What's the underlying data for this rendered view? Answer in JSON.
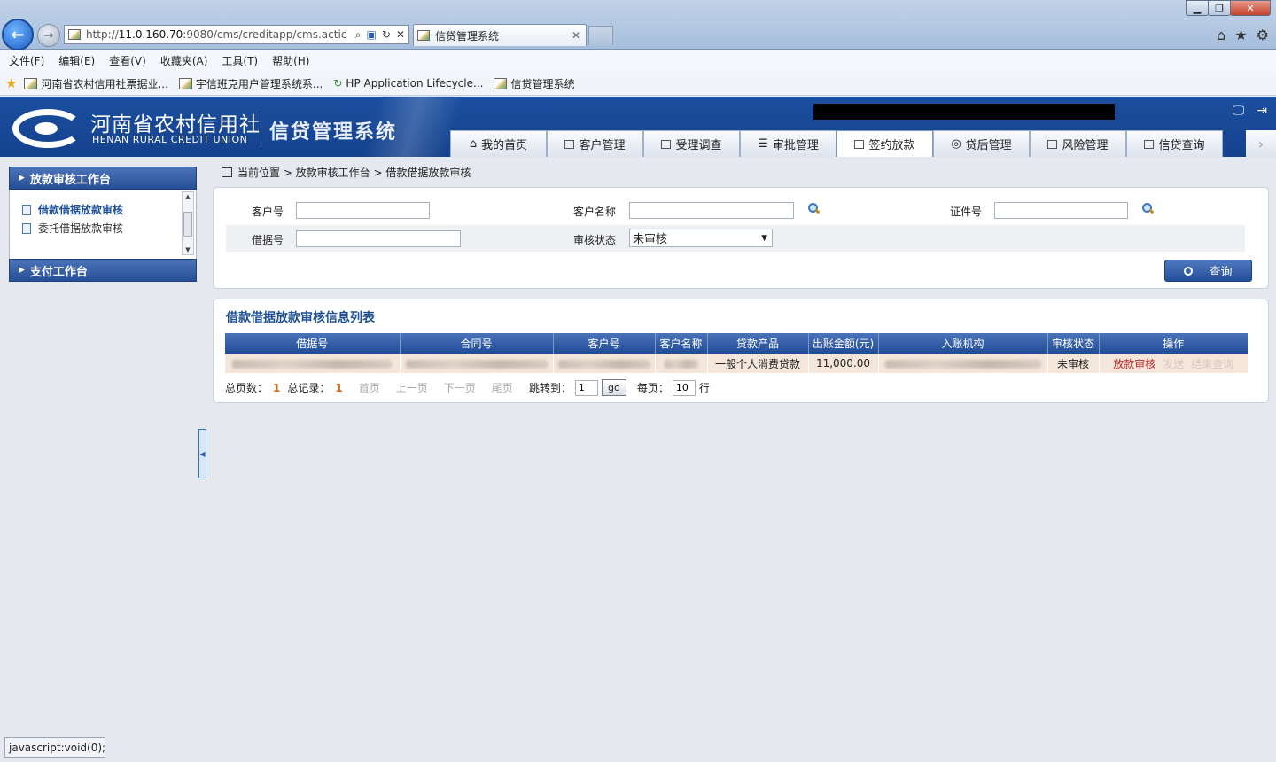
{
  "browser": {
    "url_prefix": "http://",
    "url_host": "11.0.160.70",
    "url_rest": ":9080/cms/creditapp/cms.actic",
    "tab_title": "信贷管理系统",
    "menu": [
      "文件(F)",
      "编辑(E)",
      "查看(V)",
      "收藏夹(A)",
      "工具(T)",
      "帮助(H)"
    ],
    "favorites": [
      "河南省农村信用社票据业...",
      "宇信班克用户管理系统系...",
      "HP Application Lifecycle...",
      "信贷管理系统"
    ],
    "status_text": "javascript:void(0);"
  },
  "header": {
    "logo_cn": "河南省农村信用社",
    "logo_en": "HENAN RURAL CREDIT UNION",
    "system_title": "信贷管理系统",
    "nav_tabs": [
      "我的首页",
      "客户管理",
      "受理调查",
      "审批管理",
      "签约放款",
      "贷后管理",
      "风险管理",
      "信贷查询"
    ],
    "active_tab": "签约放款"
  },
  "sidebar": {
    "section1": "放款审核工作台",
    "items": [
      "借款借据放款审核",
      "委托借据放款审核"
    ],
    "section2": "支付工作台"
  },
  "breadcrumb": "当前位置 > 放款审核工作台 > 借款借据放款审核",
  "search": {
    "customer_no_label": "客户号",
    "customer_name_label": "客户名称",
    "id_no_label": "证件号",
    "loan_no_label": "借据号",
    "status_label": "审核状态",
    "status_value": "未审核",
    "button": "查询"
  },
  "list": {
    "title": "借款借据放款审核信息列表",
    "columns": [
      "借据号",
      "合同号",
      "客户号",
      "客户名称",
      "贷款产品",
      "出账金额(元)",
      "入账机构",
      "审核状态",
      "操作"
    ],
    "rows": [
      {
        "product": "一般个人消费贷款",
        "amount": "11,000.00",
        "status": "未审核",
        "op1": "放款审核",
        "op2": "发送",
        "op3": "结果查询"
      }
    ]
  },
  "pager": {
    "total_pages_label": "总页数：",
    "total_pages": "1",
    "total_records_label": "总记录：",
    "total_records": "1",
    "first": "首页",
    "prev": "上一页",
    "next": "下一页",
    "last": "尾页",
    "jump_label": "跳转到：",
    "jump_value": "1",
    "go": "go",
    "per_page_label": "每页：",
    "per_page": "10",
    "per_page_unit": "行"
  }
}
